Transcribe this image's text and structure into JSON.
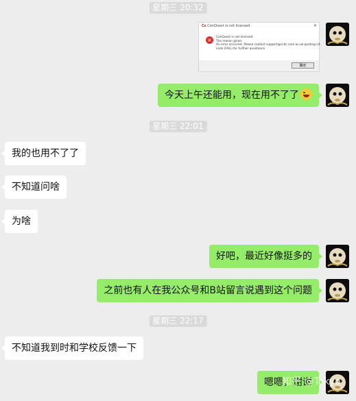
{
  "messages": [
    {
      "type": "time",
      "text": "星期三 20:32"
    },
    {
      "type": "me-image",
      "dialog": {
        "title": "ConQuest is not licensed",
        "lines": [
          "ConQuest is not licensed.",
          "The reason given:",
          "An error occurred. Please contact support@ccdc.cam.ac.uk quoting LA",
          "code (FAIL) for further assistance"
        ],
        "ok_label": "确定"
      }
    },
    {
      "type": "me",
      "text": "今天上午还能用，现在用不了了"
    },
    {
      "type": "time",
      "text": "星期三 22:01"
    },
    {
      "type": "other",
      "text": "我的也用不了了"
    },
    {
      "type": "other",
      "text": "不知道问啥"
    },
    {
      "type": "other",
      "text": "为啥"
    },
    {
      "type": "me",
      "text": "好吧，最近好像挺多的"
    },
    {
      "type": "me",
      "text": "之前也有人在我公众号和B站留言说遇到这个问题"
    },
    {
      "type": "time",
      "text": "星期三 22:17"
    },
    {
      "type": "other",
      "text": "不知道我到时和学校反馈一下"
    },
    {
      "type": "me",
      "text": "嗯嗯，谢谢"
    }
  ],
  "watermark": "知乎 @Tokyo",
  "colors": {
    "background": "#ededed",
    "my_bubble": "#95ec69",
    "other_bubble": "#ffffff",
    "timestamp_bg": "#dadada"
  },
  "icons": {
    "avatar": "ghost-avatar-icon",
    "emoji": "grin-sweat-emoji-icon",
    "dialog_error": "error-circle-icon"
  }
}
